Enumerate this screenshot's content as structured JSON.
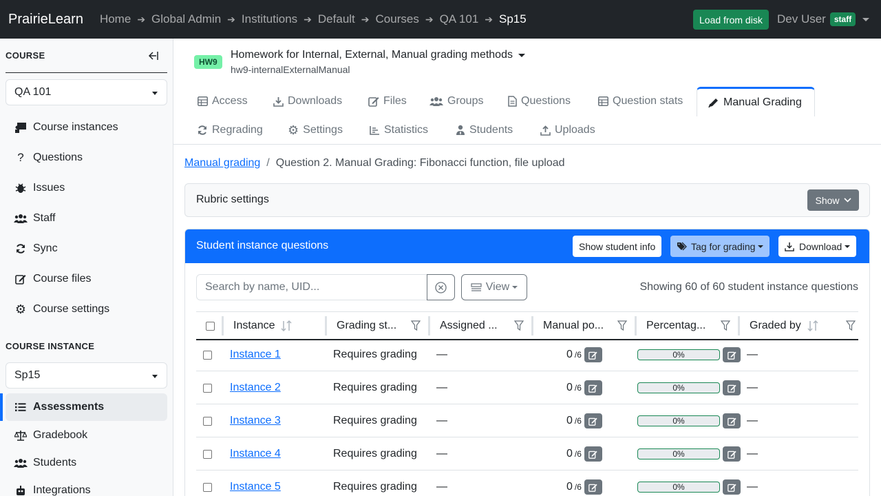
{
  "topbar": {
    "brand": "PrairieLearn",
    "breadcrumbs": [
      "Home",
      "Global Admin",
      "Institutions",
      "Default",
      "Courses",
      "QA 101",
      "Sp15"
    ],
    "load_button": "Load from disk",
    "user": "Dev User",
    "user_badge": "staff"
  },
  "sidebar": {
    "course_heading": "COURSE",
    "course_select": "QA 101",
    "course_items": [
      {
        "label": "Course instances",
        "icon": "chalkboard-icon"
      },
      {
        "label": "Questions",
        "icon": "question-icon"
      },
      {
        "label": "Issues",
        "icon": "bug-icon"
      },
      {
        "label": "Staff",
        "icon": "users-icon"
      },
      {
        "label": "Sync",
        "icon": "sync-icon"
      },
      {
        "label": "Course files",
        "icon": "edit-icon"
      },
      {
        "label": "Course settings",
        "icon": "gear-icon"
      }
    ],
    "instance_heading": "COURSE INSTANCE",
    "instance_select": "Sp15",
    "instance_items": [
      {
        "label": "Assessments",
        "icon": "list-icon",
        "active": true
      },
      {
        "label": "Gradebook",
        "icon": "scale-icon"
      },
      {
        "label": "Students",
        "icon": "users-icon"
      },
      {
        "label": "Integrations",
        "icon": "robot-icon"
      }
    ]
  },
  "assessment": {
    "badge": "HW9",
    "title": "Homework for Internal, External, Manual grading methods",
    "subtitle": "hw9-internalExternalManual"
  },
  "tabs_row1": [
    "Access",
    "Downloads",
    "Files",
    "Groups",
    "Questions",
    "Question stats",
    "Manual Grading"
  ],
  "tabs_row2": [
    "Regrading",
    "Settings",
    "Statistics",
    "Students",
    "Uploads"
  ],
  "breadcrumb": {
    "link": "Manual grading",
    "separator": "/",
    "current": "Question 2. Manual Grading: Fibonacci function, file upload"
  },
  "rubric": {
    "title": "Rubric settings",
    "show_button": "Show"
  },
  "instance_card": {
    "title": "Student instance questions",
    "show_info_button": "Show student info",
    "tag_button": "Tag for grading",
    "download_button": "Download",
    "search_placeholder": "Search by name, UID...",
    "view_button": "View",
    "showing_text": "Showing 60 of 60 student instance questions",
    "columns": [
      "Instance",
      "Grading st...",
      "Assigned ...",
      "Manual po...",
      "Percentag...",
      "Graded by"
    ],
    "rows": [
      {
        "instance": "Instance 1",
        "status": "Requires grading",
        "assigned": "—",
        "points": "0",
        "max": "/6",
        "percent": "0%",
        "graded_by": "—"
      },
      {
        "instance": "Instance 2",
        "status": "Requires grading",
        "assigned": "—",
        "points": "0",
        "max": "/6",
        "percent": "0%",
        "graded_by": "—"
      },
      {
        "instance": "Instance 3",
        "status": "Requires grading",
        "assigned": "—",
        "points": "0",
        "max": "/6",
        "percent": "0%",
        "graded_by": "—"
      },
      {
        "instance": "Instance 4",
        "status": "Requires grading",
        "assigned": "—",
        "points": "0",
        "max": "/6",
        "percent": "0%",
        "graded_by": "—"
      },
      {
        "instance": "Instance 5",
        "status": "Requires grading",
        "assigned": "—",
        "points": "0",
        "max": "/6",
        "percent": "0%",
        "graded_by": "—"
      }
    ]
  },
  "colors": {
    "navbar": "#212529",
    "primary": "#0d6efd",
    "success": "#198754",
    "badge_green": "#75f0a8"
  }
}
